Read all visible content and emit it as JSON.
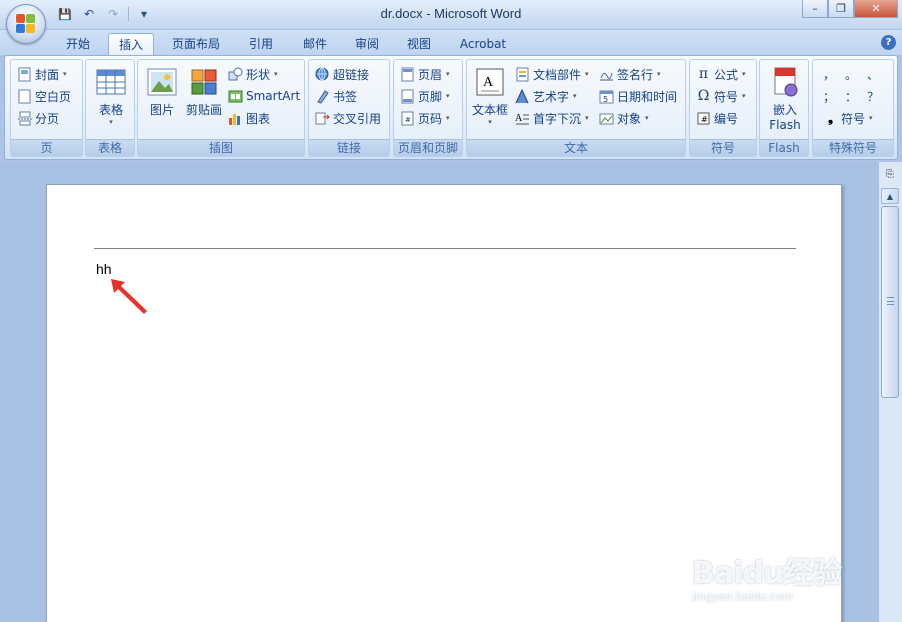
{
  "window": {
    "title": "dr.docx - Microsoft Word",
    "minimize": "–",
    "restore": "❐",
    "close": "✕"
  },
  "qat": {
    "save": "💾",
    "undo": "↶",
    "redo": "↷",
    "customize": "▾"
  },
  "tabs": [
    {
      "label": "开始"
    },
    {
      "label": "插入"
    },
    {
      "label": "页面布局"
    },
    {
      "label": "引用"
    },
    {
      "label": "邮件"
    },
    {
      "label": "审阅"
    },
    {
      "label": "视图"
    },
    {
      "label": "Acrobat"
    }
  ],
  "active_tab": "插入",
  "help": "?",
  "ribbon": {
    "page": {
      "name": "页",
      "cover": "封面",
      "blank_page": "空白页",
      "page_break": "分页"
    },
    "table": {
      "name": "表格",
      "table": "表格"
    },
    "illustrations": {
      "name": "插图",
      "picture": "图片",
      "clipart": "剪贴画",
      "shapes": "形状",
      "smartart": "SmartArt",
      "chart": "图表"
    },
    "links": {
      "name": "链接",
      "hyperlink": "超链接",
      "bookmark": "书签",
      "cross_reference": "交叉引用"
    },
    "header_footer": {
      "name": "页眉和页脚",
      "header": "页眉",
      "footer": "页脚",
      "page_number": "页码"
    },
    "text": {
      "name": "文本",
      "textbox": "文本框",
      "quick_parts": "文档部件",
      "wordart": "艺术字",
      "dropcap": "首字下沉",
      "signature": "签名行",
      "datetime": "日期和时间",
      "object": "对象"
    },
    "symbols": {
      "name": "符号",
      "equation": "公式",
      "symbol": "符号",
      "numbering": "编号"
    },
    "flash": {
      "name": "Flash",
      "embed_line1": "嵌入",
      "embed_line2": "Flash"
    },
    "special": {
      "name": "特殊符号",
      "c1": "，",
      "c2": "。",
      "c3": "、",
      "c4": "；",
      "c5": "：",
      "c6": "？",
      "symbol": "符号"
    }
  },
  "document": {
    "text": "hh"
  },
  "watermark": {
    "logo": "Baidu经验",
    "url": "jingyan.baidu.com"
  },
  "colors": {
    "accent": "#15428b",
    "arrow": "#e8332a"
  }
}
